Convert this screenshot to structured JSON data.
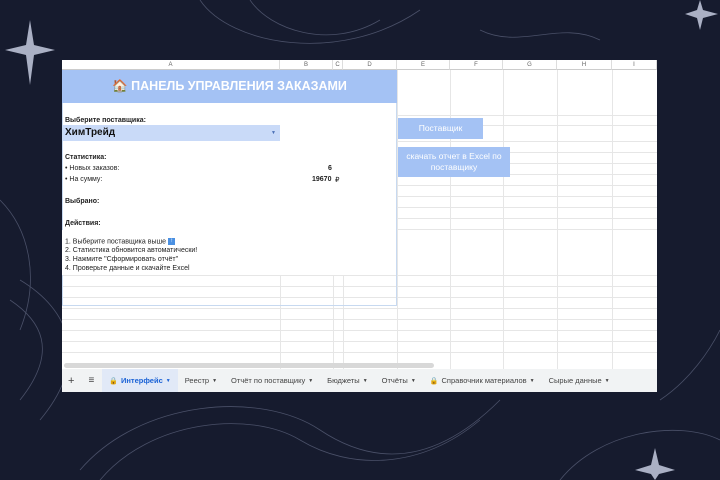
{
  "columns": [
    "A",
    "B",
    "C",
    "D",
    "E",
    "F",
    "G",
    "H",
    "I"
  ],
  "banner": {
    "icon": "🏠",
    "title": "ПАНЕЛЬ УПРАВЛЕНИЯ ЗАКАЗАМИ"
  },
  "supplier": {
    "label": "Выберите поставщика:",
    "value": "ХимТрейд"
  },
  "stats": {
    "title": "Статистика:",
    "new_orders_label": "• Новых заказов:",
    "new_orders_value": "6",
    "sum_label": "• На сумму:",
    "sum_value": "19670",
    "currency": "₽"
  },
  "selected_label": "Выбрано:",
  "actions": {
    "title": "Действия:",
    "steps": [
      "1. Выберите поставщика выше",
      "2. Статистика обновится автоматически!",
      "3. Нажмите \"Сформировать отчёт\"",
      "4. Проверьте данные и скачайте Excel"
    ]
  },
  "buttons": {
    "supplier": "Поставщик",
    "download": "скачать отчет в Excel по поставщику"
  },
  "tabs": [
    {
      "label": "Интерфейс",
      "locked": true,
      "active": true
    },
    {
      "label": "Реестр"
    },
    {
      "label": "Отчёт по поставщику"
    },
    {
      "label": "Бюджеты"
    },
    {
      "label": "Отчёты"
    },
    {
      "label": "Справочник материалов",
      "locked": true
    },
    {
      "label": "Сырые данные"
    }
  ],
  "colors": {
    "accent": "#a4c2f4",
    "background": "#161b2e"
  }
}
